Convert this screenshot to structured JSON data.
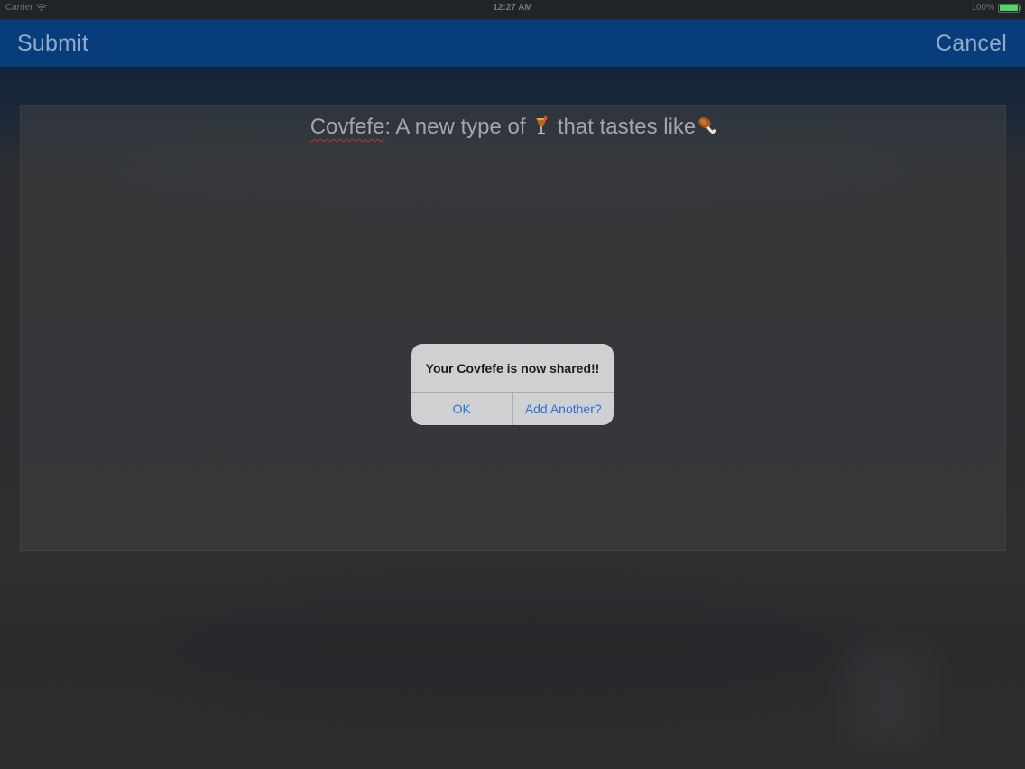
{
  "status_bar": {
    "carrier": "Carrier",
    "time": "12:27 AM",
    "battery": "100%",
    "battery_level": 1.0,
    "battery_color": "#4cd964"
  },
  "nav_bar": {
    "left_label": "Submit",
    "right_label": "Cancel",
    "color": "#063d7a"
  },
  "editor": {
    "misspelled_word": "Covfefe",
    "text_part_1": ": A new type of ",
    "emoji_1": "tropical-drink-icon",
    "text_part_2": " that tastes like",
    "emoji_2": "poultry-leg-icon"
  },
  "alert": {
    "title": "Your Covfefe is now shared!!",
    "ok_label": "OK",
    "add_another_label": "Add Another?",
    "button_color": "#2f6fd6"
  }
}
